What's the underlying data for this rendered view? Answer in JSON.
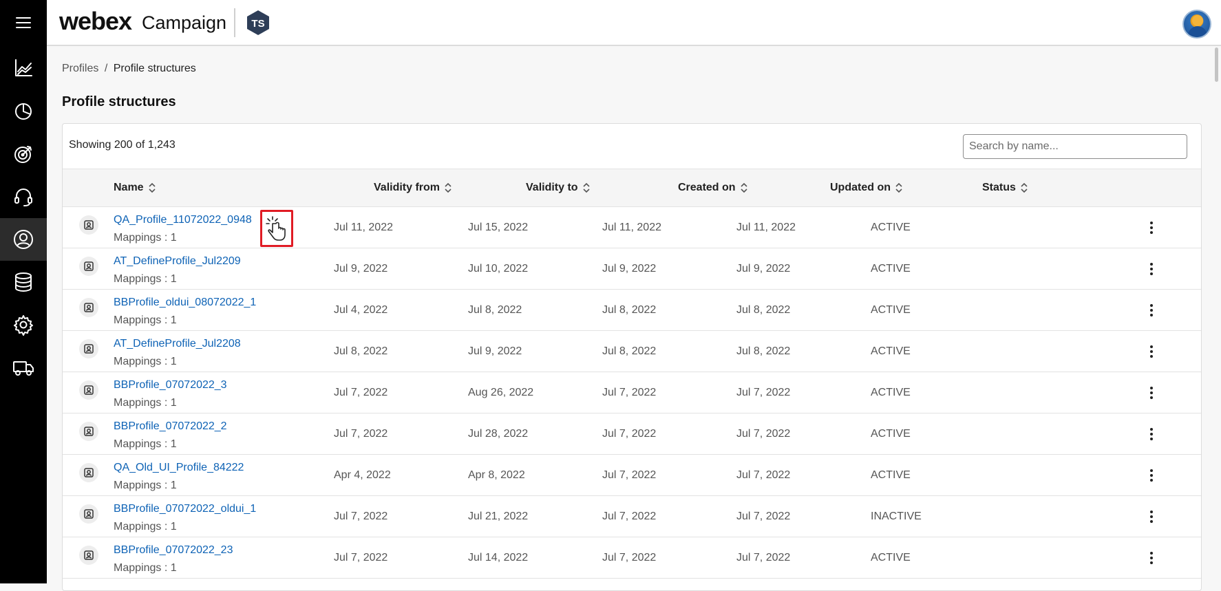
{
  "app": {
    "brand_webex": "webex",
    "brand_product": "Campaign"
  },
  "sidebar": {
    "items": [
      {
        "name": "menu",
        "icon": "hamburger-menu-icon"
      },
      {
        "name": "analytics",
        "icon": "line-chart-icon"
      },
      {
        "name": "reports",
        "icon": "pie-chart-icon"
      },
      {
        "name": "campaigns",
        "icon": "target-icon"
      },
      {
        "name": "contact-center",
        "icon": "headset-icon"
      },
      {
        "name": "profiles",
        "icon": "user-circle-icon",
        "active": true
      },
      {
        "name": "data",
        "icon": "database-icon"
      },
      {
        "name": "settings",
        "icon": "gear-icon"
      },
      {
        "name": "delivery",
        "icon": "truck-icon"
      }
    ]
  },
  "breadcrumb": {
    "parent": "Profiles",
    "separator": "/",
    "current": "Profile structures"
  },
  "page": {
    "title": "Profile structures",
    "showing_text": "Showing 200 of 1,243",
    "search_placeholder": "Search by name..."
  },
  "table": {
    "columns": {
      "name": "Name",
      "validity_from": "Validity from",
      "validity_to": "Validity to",
      "created_on": "Created on",
      "updated_on": "Updated on",
      "status": "Status"
    },
    "rows": [
      {
        "name": "QA_Profile_11072022_0948",
        "mappings": "Mappings : 1",
        "validity_from": "Jul 11, 2022",
        "validity_to": "Jul 15, 2022",
        "created_on": "Jul 11, 2022",
        "updated_on": "Jul 11, 2022",
        "status": "ACTIVE"
      },
      {
        "name": "AT_DefineProfile_Jul2209",
        "mappings": "Mappings : 1",
        "validity_from": "Jul 9, 2022",
        "validity_to": "Jul 10, 2022",
        "created_on": "Jul 9, 2022",
        "updated_on": "Jul 9, 2022",
        "status": "ACTIVE"
      },
      {
        "name": "BBProfile_oldui_08072022_1",
        "mappings": "Mappings : 1",
        "validity_from": "Jul 4, 2022",
        "validity_to": "Jul 8, 2022",
        "created_on": "Jul 8, 2022",
        "updated_on": "Jul 8, 2022",
        "status": "ACTIVE"
      },
      {
        "name": "AT_DefineProfile_Jul2208",
        "mappings": "Mappings : 1",
        "validity_from": "Jul 8, 2022",
        "validity_to": "Jul 9, 2022",
        "created_on": "Jul 8, 2022",
        "updated_on": "Jul 8, 2022",
        "status": "ACTIVE"
      },
      {
        "name": "BBProfile_07072022_3",
        "mappings": "Mappings : 1",
        "validity_from": "Jul 7, 2022",
        "validity_to": "Aug 26, 2022",
        "created_on": "Jul 7, 2022",
        "updated_on": "Jul 7, 2022",
        "status": "ACTIVE"
      },
      {
        "name": "BBProfile_07072022_2",
        "mappings": "Mappings : 1",
        "validity_from": "Jul 7, 2022",
        "validity_to": "Jul 28, 2022",
        "created_on": "Jul 7, 2022",
        "updated_on": "Jul 7, 2022",
        "status": "ACTIVE"
      },
      {
        "name": "QA_Old_UI_Profile_84222",
        "mappings": "Mappings : 1",
        "validity_from": "Apr 4, 2022",
        "validity_to": "Apr 8, 2022",
        "created_on": "Jul 7, 2022",
        "updated_on": "Jul 7, 2022",
        "status": "ACTIVE"
      },
      {
        "name": "BBProfile_07072022_oldui_1",
        "mappings": "Mappings : 1",
        "validity_from": "Jul 7, 2022",
        "validity_to": "Jul 21, 2022",
        "created_on": "Jul 7, 2022",
        "updated_on": "Jul 7, 2022",
        "status": "INACTIVE"
      },
      {
        "name": "BBProfile_07072022_23",
        "mappings": "Mappings : 1",
        "validity_from": "Jul 7, 2022",
        "validity_to": "Jul 14, 2022",
        "created_on": "Jul 7, 2022",
        "updated_on": "Jul 7, 2022",
        "status": "ACTIVE"
      }
    ]
  },
  "colors": {
    "sidebar_bg": "#000000",
    "link": "#0d62b5",
    "highlight_box": "#e01b24"
  }
}
